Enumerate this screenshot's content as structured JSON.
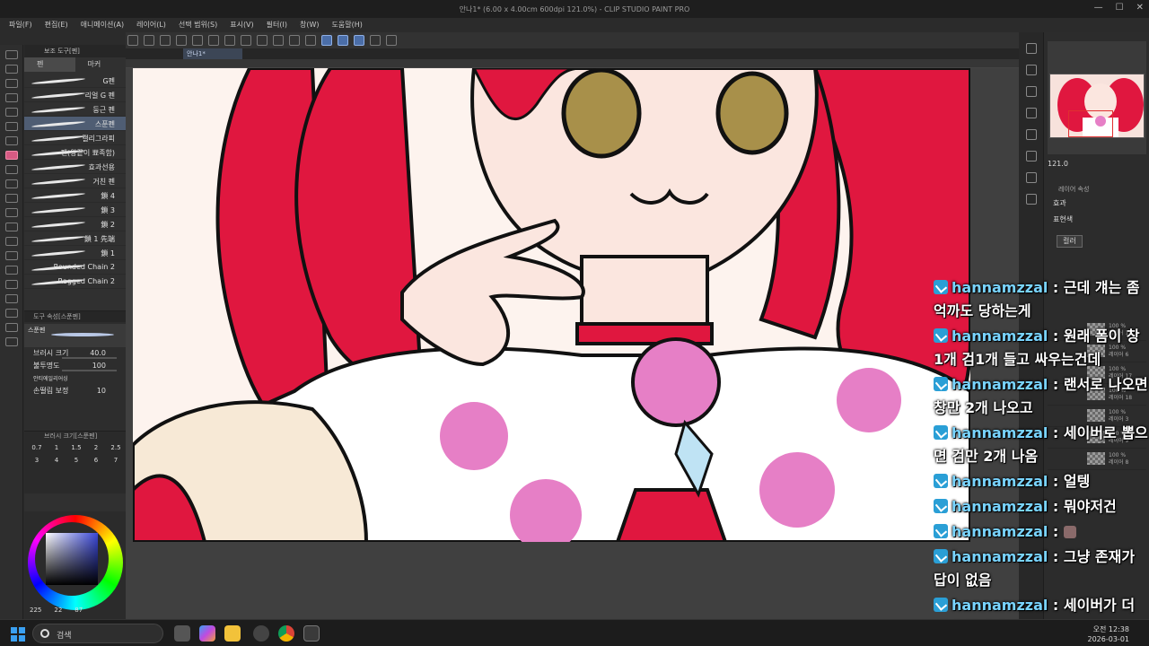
{
  "window": {
    "title": "안나1* (6.00 x 4.00cm 600dpi 121.0%)  - CLIP STUDIO PAINT PRO",
    "controls": [
      "—",
      "☐",
      "✕"
    ]
  },
  "menu": [
    "파일(F)",
    "편집(E)",
    "애니메이션(A)",
    "레이어(L)",
    "선택 범위(S)",
    "표시(V)",
    "필터(I)",
    "창(W)",
    "도움말(H)"
  ],
  "tab": {
    "label": "안나1*"
  },
  "left_panel": {
    "header": "보조 도구[펜]",
    "tabs": [
      "펜",
      "마커"
    ],
    "brushes": [
      {
        "label": "G펜"
      },
      {
        "label": "리얼 G 펜"
      },
      {
        "label": "둥근 펜"
      },
      {
        "label": "스푼펜"
      },
      {
        "label": "캘리그라피"
      },
      {
        "label": "펜(왕끝이 뾰족함)"
      },
      {
        "label": "효과선용"
      },
      {
        "label": "거친 펜"
      },
      {
        "label": "鎖 4"
      },
      {
        "label": "鎖 3"
      },
      {
        "label": "鎖 2"
      },
      {
        "label": "鎖 1 先端"
      },
      {
        "label": "鎖 1"
      },
      {
        "label": "Rounded Chain 2"
      },
      {
        "label": "Ragged Chain 2"
      }
    ],
    "tool_property": {
      "header": "도구 속성[스푼펜]",
      "preview_label": "스푼펜",
      "rows": [
        {
          "label": "브러시 크기",
          "value": "40.0"
        },
        {
          "label": "불투명도",
          "value": "100"
        },
        {
          "label": "안티에일리어싱",
          "value": ""
        },
        {
          "label": "손떨림 보정",
          "value": "10"
        }
      ]
    },
    "size_panel": {
      "header": "브러시 크기[스푼펜]",
      "sizes": [
        "0.7",
        "1",
        "1.5",
        "2",
        "2.5",
        "3",
        "4",
        "5",
        "6",
        "7"
      ]
    },
    "color_values": [
      "225",
      "22",
      "87"
    ]
  },
  "navigator": {
    "zoom": "121.0"
  },
  "layer_property": {
    "header": "레이어 속성",
    "effect_label": "효과",
    "expression_label": "표현색",
    "expression_value": "컬러"
  },
  "layers": [
    {
      "opacity": "100 %",
      "name": "레이어 16"
    },
    {
      "opacity": "100 %",
      "name": "레이어 6"
    },
    {
      "opacity": "100 %",
      "name": "레이어 17"
    },
    {
      "opacity": "100 %",
      "name": "레이어 18"
    },
    {
      "opacity": "100 %",
      "name": "레이어 3"
    },
    {
      "opacity": "100 %",
      "name": "레이어 9"
    },
    {
      "opacity": "100 %",
      "name": "레이어 8"
    }
  ],
  "chat": [
    {
      "user": "hannamzzal",
      "text": "근데 걔는 좀 억까도 당하는게"
    },
    {
      "user": "hannamzzal",
      "text": "원래 폼이 창1개 검1개 들고 싸우는건데"
    },
    {
      "user": "hannamzzal",
      "text": "랜서로 나오면 창만 2개 나오고"
    },
    {
      "user": "hannamzzal",
      "text": "세이버로 뽑으면 검만 2개 나옴"
    },
    {
      "user": "hannamzzal",
      "text": "얼텡"
    },
    {
      "user": "hannamzzal",
      "text": "뭐야저건"
    },
    {
      "user": "hannamzzal",
      "text": ""
    },
    {
      "user": "hannamzzal",
      "text": "그냥 존재가 답이 없음"
    },
    {
      "user": "hannamzzal",
      "text": "세이버가 더 세긴 할거임"
    }
  ],
  "taskbar": {
    "search_placeholder": "검색",
    "time": "오전 12:38",
    "date": "2026-03-01"
  },
  "colors": {
    "hair": "#e0173f",
    "skin": "#fbe6df",
    "eyes": "#a8904a",
    "rose": "#e67fc6",
    "accent": "#4b6ea8"
  }
}
